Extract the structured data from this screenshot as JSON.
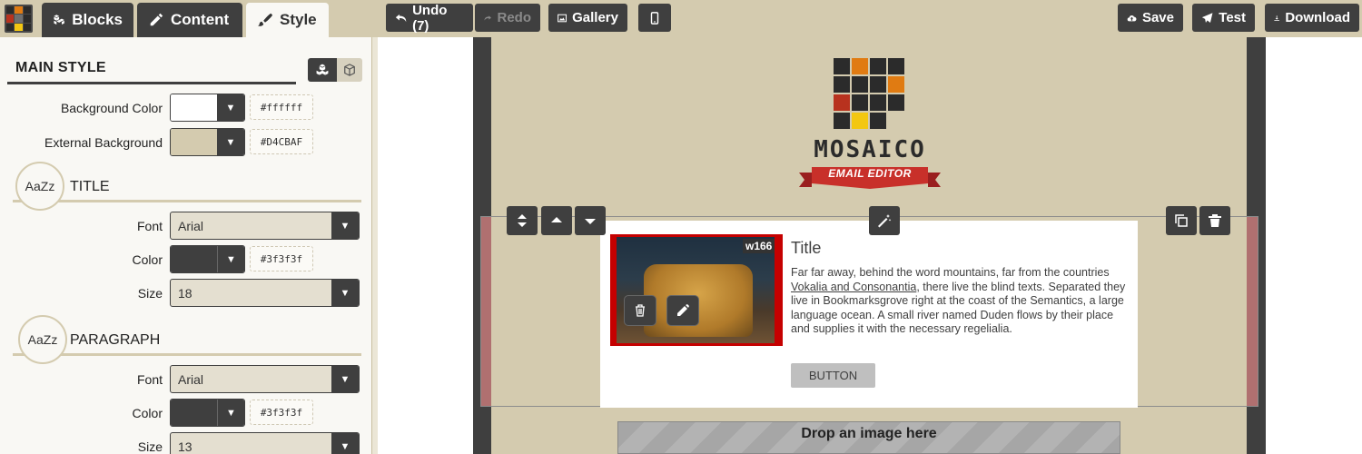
{
  "toolbar": {
    "tabs": [
      {
        "label": "Blocks",
        "icon": "cubes-icon"
      },
      {
        "label": "Content",
        "icon": "pencil-icon"
      },
      {
        "label": "Style",
        "icon": "brush-icon",
        "active": true
      }
    ],
    "undo_label": "Undo (7)",
    "redo_label": "Redo",
    "gallery_label": "Gallery",
    "save_label": "Save",
    "test_label": "Test",
    "download_label": "Download"
  },
  "panel": {
    "main_style_title": "MAIN STYLE",
    "background_color": {
      "label": "Background Color",
      "value": "#ffffff",
      "hex": "#ffffff"
    },
    "external_background": {
      "label": "External Background",
      "value": "#D4CBAF",
      "hex": "#D4CBAF"
    },
    "title_section": {
      "badge": "AaZz",
      "title": "TITLE",
      "font_label": "Font",
      "font_value": "Arial",
      "color_label": "Color",
      "color_value": "#3f3f3f",
      "color_hex": "#3f3f3f",
      "size_label": "Size",
      "size_value": "18"
    },
    "paragraph_section": {
      "badge": "AaZz",
      "title": "PARAGRAPH",
      "font_label": "Font",
      "font_value": "Arial",
      "color_label": "Color",
      "color_value": "#3f3f3f",
      "color_hex": "#3f3f3f",
      "size_label": "Size",
      "size_value": "13"
    }
  },
  "email": {
    "logo_word": "MOSAICO",
    "logo_ribbon": "EMAIL EDITOR",
    "image_width_badge": "w166",
    "title": "Title",
    "para_before": "Far far away, behind the word mountains, far from the countries ",
    "para_link": "Vokalia and Consonantia",
    "para_after": ", there live the blind texts. Separated they live in Bookmarksgrove right at the coast of the Semantics, a large language ocean. A small river named Duden flows by their place and supplies it with the necessary regelialia.",
    "button_label": "BUTTON",
    "dropzone_label": "Drop an image here"
  },
  "colors": {
    "accent_dark": "#3f3f3f",
    "external_bg": "#D4CBAF",
    "selection_bar": "#b07070",
    "image_border": "#c50000"
  }
}
